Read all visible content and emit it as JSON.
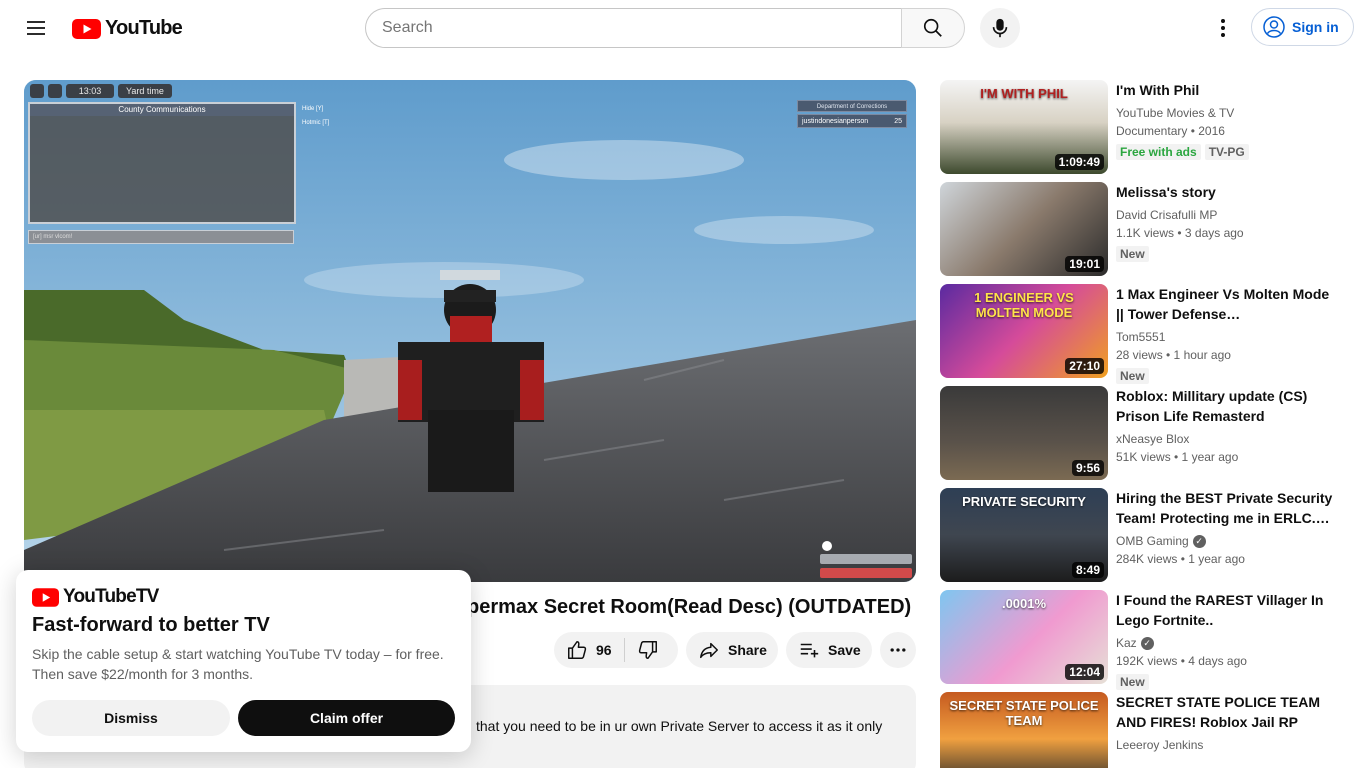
{
  "header": {
    "logo_text": "YouTube",
    "search_placeholder": "Search",
    "signin_label": "Sign in"
  },
  "player": {
    "hud_time": "13:03",
    "hud_label": "Yard time",
    "comms_title": "County Communications",
    "comms_input": "[ur] msr vlcom!",
    "radio_options": [
      "Hide [Y]",
      "Hotmic [T]"
    ],
    "doc_title": "Department of Corrections",
    "doc_user": "justindonesianperson",
    "doc_count": "25"
  },
  "video": {
    "title_visible": "permax Secret Room(Read Desc) (OUTDATED)",
    "like_count": "96",
    "share_label": "Share",
    "save_label": "Save",
    "description_visible": "that you need to be in ur own Private Server to access it as it only"
  },
  "promo": {
    "logo_text": "YouTubeTV",
    "heading": "Fast-forward to better TV",
    "body": "Skip the cable setup & start watching YouTube TV today – for free. Then save $22/month for 3 months.",
    "dismiss_label": "Dismiss",
    "claim_label": "Claim offer"
  },
  "recommendations": [
    {
      "title": "I'm With Phil",
      "channel": "YouTube Movies & TV",
      "meta": "Documentary • 2016",
      "duration": "1:09:49",
      "badges": [
        "Free with ads",
        "TV-PG"
      ],
      "verified": false,
      "thumb_text": "I'M WITH PHIL"
    },
    {
      "title": "Melissa's story",
      "channel": "David Crisafulli MP",
      "meta": "1.1K views  • 3 days ago",
      "duration": "19:01",
      "badges": [
        "New"
      ],
      "verified": false,
      "thumb_text": ""
    },
    {
      "title": "1 Max Engineer Vs Molten Mode || Tower Defense…",
      "channel": "Tom5551",
      "meta": "28 views  • 1 hour ago",
      "duration": "27:10",
      "badges": [
        "New"
      ],
      "verified": false,
      "thumb_text": "1 ENGINEER VS MOLTEN MODE"
    },
    {
      "title": "Roblox: Millitary update (CS) Prison Life Remasterd",
      "channel": "xNeasye Blox",
      "meta": "51K views  • 1 year ago",
      "duration": "9:56",
      "badges": [],
      "verified": false,
      "thumb_text": ""
    },
    {
      "title": "Hiring the BEST Private Security Team! Protecting me in ERLC.…",
      "channel": "OMB Gaming",
      "meta": "284K views  • 1 year ago",
      "duration": "8:49",
      "badges": [],
      "verified": true,
      "thumb_text": "PRIVATE SECURITY"
    },
    {
      "title": "I Found the RAREST Villager In Lego Fortnite..",
      "channel": "Kaz",
      "meta": "192K views  • 4 days ago",
      "duration": "12:04",
      "badges": [
        "New"
      ],
      "verified": true,
      "thumb_text": ".0001%"
    },
    {
      "title": "SECRET STATE POLICE TEAM AND FIRES! Roblox Jail RP",
      "channel": "Leeeroy Jenkins",
      "meta": "",
      "duration": "",
      "badges": [],
      "verified": false,
      "thumb_text": "SECRET STATE POLICE TEAM"
    }
  ]
}
